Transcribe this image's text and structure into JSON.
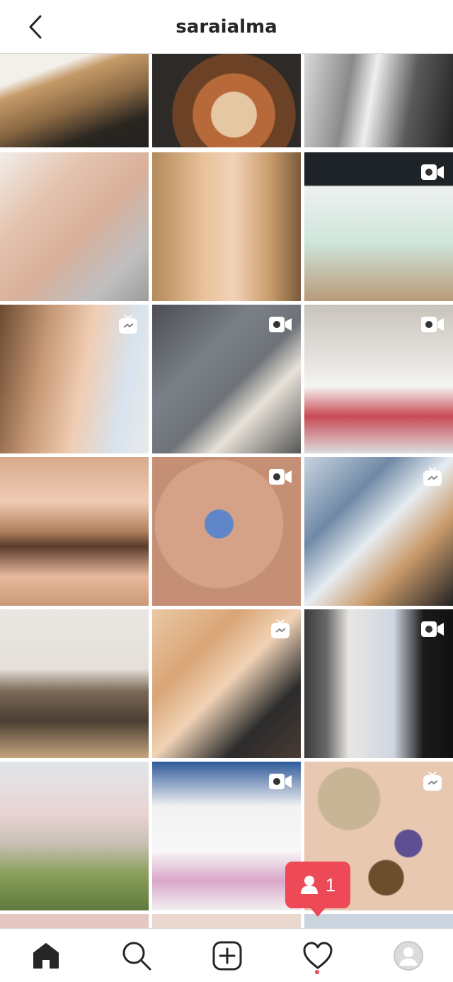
{
  "header": {
    "title": "saraialma",
    "back_icon": "chevron-left-icon"
  },
  "grid": {
    "tiles": [
      {
        "name": "post-portrait-blonde",
        "badge": null
      },
      {
        "name": "post-ramen",
        "badge": null
      },
      {
        "name": "post-portrait-bw",
        "badge": null
      },
      {
        "name": "post-nails",
        "badge": null
      },
      {
        "name": "post-face-selfie",
        "badge": null
      },
      {
        "name": "post-sephora-mask",
        "badge": "video-icon"
      },
      {
        "name": "post-makeup-look",
        "badge": "igtv-icon"
      },
      {
        "name": "post-jeans",
        "badge": "video-icon"
      },
      {
        "name": "post-primer",
        "badge": "video-icon"
      },
      {
        "name": "post-eye-makeup",
        "badge": null
      },
      {
        "name": "post-tattoo-boat",
        "badge": "video-icon"
      },
      {
        "name": "post-brushes",
        "badge": "igtv-icon"
      },
      {
        "name": "post-cat",
        "badge": null
      },
      {
        "name": "post-palette",
        "badge": "igtv-icon"
      },
      {
        "name": "post-tattoo-seahorse",
        "badge": "video-icon"
      },
      {
        "name": "post-blossom",
        "badge": null
      },
      {
        "name": "post-polish-bottles",
        "badge": "video-icon"
      },
      {
        "name": "post-swatches",
        "badge": "igtv-icon"
      }
    ]
  },
  "notification": {
    "icon": "person-icon",
    "count": "1",
    "color": "#ed4956"
  },
  "tabbar": {
    "items": [
      {
        "icon": "home-icon",
        "active": true
      },
      {
        "icon": "search-icon",
        "active": false
      },
      {
        "icon": "add-post-icon",
        "active": false
      },
      {
        "icon": "heart-icon",
        "active": false
      },
      {
        "icon": "profile-avatar-icon",
        "active": false
      }
    ]
  }
}
